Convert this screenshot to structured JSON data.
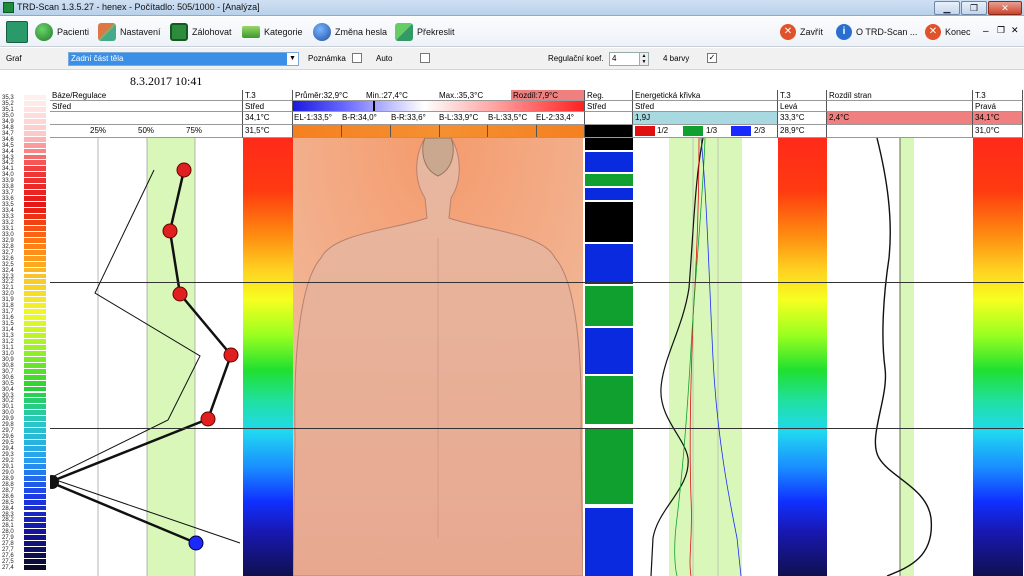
{
  "window": {
    "title": "TRD-Scan 1.3.5.27  -  henex - Počítadlo: 505/1000 - [Analýza]"
  },
  "toolbar": {
    "items": [
      "Pacienti",
      "Nastavení",
      "Zálohovat",
      "Kategorie",
      "Změna hesla",
      "Překreslit"
    ],
    "right_items": [
      "Zavřít",
      "O TRD-Scan ...",
      "Konec"
    ]
  },
  "options": {
    "graf_label": "Graf",
    "graf_value": "Zadní část těla",
    "poznamka_label": "Poznámka",
    "auto_label": "Auto",
    "regulation_label": "Regulační koef.",
    "regulation_value": "4",
    "colors_label": "4 barvy",
    "colors_checked": "✓"
  },
  "analysis": {
    "datetime": "8.3.2017 10:41",
    "baze_header": "Báze/Regulace",
    "baze_sub": "Střed",
    "pct_labels": [
      "25%",
      "50%",
      "75%"
    ],
    "t3_left": {
      "h": "T.3",
      "s": "Střed",
      "v1": "34,1°C",
      "v2": "31,5°C"
    },
    "stats": {
      "avg": "Průměr:32,9°C",
      "min": "Min.:27,4°C",
      "max": "Max.:35,3°C",
      "diff": "Rozdíl:7,9°C"
    },
    "regions": [
      "EL-1:33,5°",
      "B-R:34,0°",
      "B-R:33,6°",
      "B-L:33,9°C",
      "B-L:33,5°C",
      "EL-2:33,4°"
    ],
    "reg": {
      "h": "Reg.",
      "s": "Střed"
    },
    "energy": {
      "h": "Energetická křivka",
      "s": "Střed",
      "v": "1,9J",
      "legend": [
        "1/2",
        "1/3",
        "2/3"
      ]
    },
    "t3_mid": {
      "h": "T.3",
      "s": "Levá",
      "v1": "33,3°C",
      "v2": "28,9°C"
    },
    "rozdil": {
      "h": "Rozdíl stran",
      "v": "2,4°C"
    },
    "t3_right": {
      "h": "T.3",
      "s": "Pravá",
      "v1": "34,1°C",
      "v2": "31,0°C"
    },
    "scale": [
      "35,3",
      "35,2",
      "35,1",
      "35,0",
      "34,9",
      "34,8",
      "34,7",
      "34,6",
      "34,5",
      "34,4",
      "34,3",
      "34,2",
      "34,1",
      "34,0",
      "33,9",
      "33,8",
      "33,7",
      "33,6",
      "33,5",
      "33,4",
      "33,3",
      "33,2",
      "33,1",
      "33,0",
      "32,9",
      "32,8",
      "32,7",
      "32,6",
      "32,5",
      "32,4",
      "32,3",
      "32,2",
      "32,1",
      "32,0",
      "31,9",
      "31,8",
      "31,7",
      "31,6",
      "31,5",
      "31,4",
      "31,3",
      "31,2",
      "31,1",
      "31,0",
      "30,9",
      "30,8",
      "30,7",
      "30,6",
      "30,5",
      "30,4",
      "30,3",
      "30,2",
      "30,1",
      "30,0",
      "29,9",
      "29,8",
      "29,7",
      "29,6",
      "29,5",
      "29,4",
      "29,3",
      "29,2",
      "29,1",
      "29,0",
      "28,9",
      "28,8",
      "28,7",
      "28,6",
      "28,5",
      "28,4",
      "28,3",
      "28,2",
      "28,1",
      "28,0",
      "27,9",
      "27,8",
      "27,7",
      "27,6",
      "27,5",
      "27,4"
    ]
  },
  "colors": {
    "accent_red": "#d9263a",
    "green_zone": "#d8f7b8",
    "stat_red": "#f08080"
  }
}
